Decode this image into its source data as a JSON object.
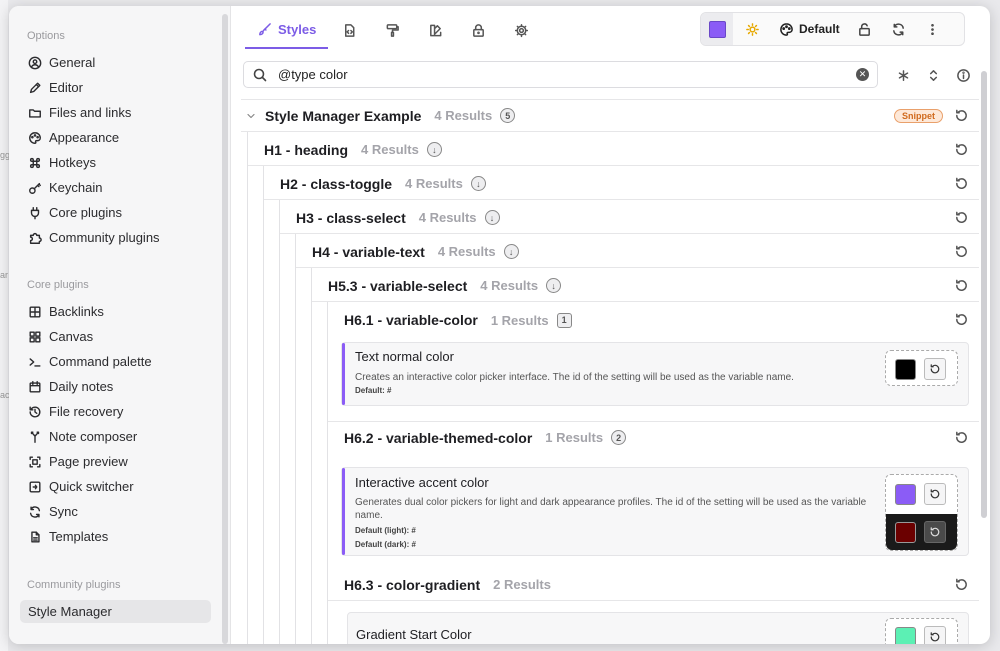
{
  "sidebar": {
    "options_label": "Options",
    "options": [
      {
        "label": "General",
        "icon": "gear-circle-icon"
      },
      {
        "label": "Editor",
        "icon": "pencil-icon"
      },
      {
        "label": "Files and links",
        "icon": "folder-icon"
      },
      {
        "label": "Appearance",
        "icon": "palette-icon"
      },
      {
        "label": "Hotkeys",
        "icon": "command-icon"
      },
      {
        "label": "Keychain",
        "icon": "key-icon"
      },
      {
        "label": "Core plugins",
        "icon": "plug-icon"
      },
      {
        "label": "Community plugins",
        "icon": "puzzle-icon"
      }
    ],
    "core_label": "Core plugins",
    "core": [
      {
        "label": "Backlinks",
        "icon": "backlinks-icon"
      },
      {
        "label": "Canvas",
        "icon": "canvas-icon"
      },
      {
        "label": "Command palette",
        "icon": "terminal-icon"
      },
      {
        "label": "Daily notes",
        "icon": "calendar-icon"
      },
      {
        "label": "File recovery",
        "icon": "history-icon"
      },
      {
        "label": "Note composer",
        "icon": "merge-icon"
      },
      {
        "label": "Page preview",
        "icon": "preview-icon"
      },
      {
        "label": "Quick switcher",
        "icon": "switcher-icon"
      },
      {
        "label": "Sync",
        "icon": "sync-icon"
      },
      {
        "label": "Templates",
        "icon": "templates-icon"
      }
    ],
    "community_label": "Community plugins",
    "community": [
      {
        "label": "Style Manager"
      }
    ]
  },
  "tabs": {
    "styles_label": "Styles"
  },
  "toolbar": {
    "accent_color": "#8b5cf6",
    "theme_label": "Default"
  },
  "search": {
    "value": "@type color"
  },
  "tree": {
    "root": {
      "title": "Style Manager Example",
      "count": "4 Results",
      "badge": "5",
      "tag": "Snippet"
    },
    "h1": {
      "title": "H1 - heading",
      "count": "4 Results"
    },
    "h2": {
      "title": "H2 - class-toggle",
      "count": "4 Results"
    },
    "h3": {
      "title": "H3 - class-select",
      "count": "4 Results"
    },
    "h4": {
      "title": "H4 - variable-text",
      "count": "4 Results"
    },
    "h5": {
      "title": "H5.3 - variable-select",
      "count": "4 Results"
    },
    "h61": {
      "title": "H6.1 - variable-color",
      "count": "1 Results",
      "badge": "1"
    },
    "h62": {
      "title": "H6.2 - variable-themed-color",
      "count": "1 Results",
      "badge": "2"
    },
    "h63": {
      "title": "H6.3 - color-gradient",
      "count": "2 Results"
    }
  },
  "cards": {
    "text_normal": {
      "title": "Text normal color",
      "desc": "Creates an interactive color picker interface. The id of the setting will be used as the variable name.",
      "default": "Default: #",
      "color": "#000000"
    },
    "accent": {
      "title": "Interactive accent color",
      "desc": "Generates dual color pickers for light and dark appearance profiles. The id of the setting will be used as the variable name.",
      "default_light": "Default (light): #",
      "default_dark": "Default (dark): #",
      "light_color": "#8b5cf6",
      "dark_color": "#6b0000"
    },
    "gradient": {
      "title": "Gradient Start Color",
      "color": "#5cf0b4"
    }
  }
}
